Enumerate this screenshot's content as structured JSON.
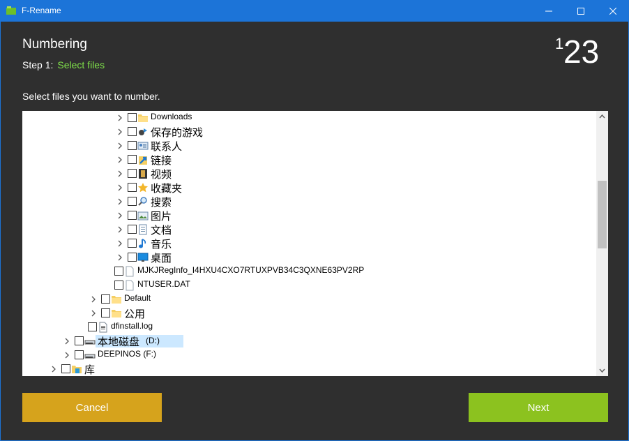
{
  "window": {
    "title": "F-Rename"
  },
  "header": {
    "title": "Numbering",
    "step_prefix": "Step 1:",
    "step_name": "Select files",
    "logo_text": "123"
  },
  "instruction": "Select files you want to number.",
  "tree": {
    "items": [
      {
        "label": "Downloads",
        "icon": "folder-icon",
        "expandable": true
      },
      {
        "label": "保存的游戏",
        "icon": "saved-games-icon",
        "expandable": true
      },
      {
        "label": "联系人",
        "icon": "contacts-icon",
        "expandable": true
      },
      {
        "label": "链接",
        "icon": "links-icon",
        "expandable": true
      },
      {
        "label": "视频",
        "icon": "videos-icon",
        "expandable": true
      },
      {
        "label": "收藏夹",
        "icon": "favorites-star-icon",
        "expandable": true
      },
      {
        "label": "搜索",
        "icon": "searches-icon",
        "expandable": true
      },
      {
        "label": "图片",
        "icon": "pictures-icon",
        "expandable": true
      },
      {
        "label": "文档",
        "icon": "documents-icon",
        "expandable": true
      },
      {
        "label": "音乐",
        "icon": "music-icon",
        "expandable": true
      },
      {
        "label": "桌面",
        "icon": "desktop-icon",
        "expandable": true
      },
      {
        "label": "MJKJRegInfo_I4HXU4CXO7RTUXPVB34C3QXNE63PV2RP",
        "icon": "file-icon",
        "expandable": false
      },
      {
        "label": "NTUSER.DAT",
        "icon": "file-icon",
        "expandable": false
      },
      {
        "label": "Default",
        "icon": "folder-icon",
        "expandable": true
      },
      {
        "label": "公用",
        "icon": "folder-icon",
        "expandable": true
      },
      {
        "label": "dfinstall.log",
        "icon": "text-file-icon",
        "expandable": false
      },
      {
        "label": "本地磁盘",
        "label_suffix": "(D:)",
        "icon": "drive-icon",
        "expandable": true,
        "selected": true
      },
      {
        "label": "DEEPINOS (F:)",
        "icon": "drive-icon",
        "expandable": true
      },
      {
        "label": "库",
        "icon": "library-icon",
        "expandable": true
      }
    ]
  },
  "buttons": {
    "cancel": "Cancel",
    "next": "Next"
  },
  "colors": {
    "titlebar": "#1c74d8",
    "background": "#2f2f2f",
    "step_accent": "#7fe04a",
    "cancel": "#d6a31c",
    "next": "#8cc21f",
    "selection": "#cce8ff"
  }
}
